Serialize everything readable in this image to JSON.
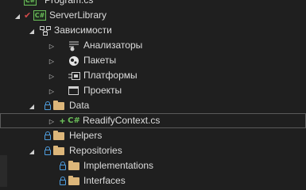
{
  "tree": {
    "program_cs_label": "Program.cs",
    "project_label": "ServerLibrary",
    "dependencies_label": "Зависимости",
    "analyzers_label": "Анализаторы",
    "packages_label": "Пакеты",
    "platforms_label": "Платформы",
    "projects_label": "Проекты",
    "data_folder_label": "Data",
    "readify_context_label": "ReadifyContext.cs",
    "helpers_folder_label": "Helpers",
    "repositories_folder_label": "Repositories",
    "implementations_folder_label": "Implementations",
    "interfaces_folder_label": "Interfaces",
    "cs_icon_text": "C#",
    "added_marker": "+"
  },
  "colors": {
    "background": "#1f1f1f",
    "text": "#dcdcdc",
    "folder": "#dcb67a",
    "csharp": "#6cbf5a",
    "lock": "#4f9fe0",
    "check_error": "#d04a4a"
  }
}
